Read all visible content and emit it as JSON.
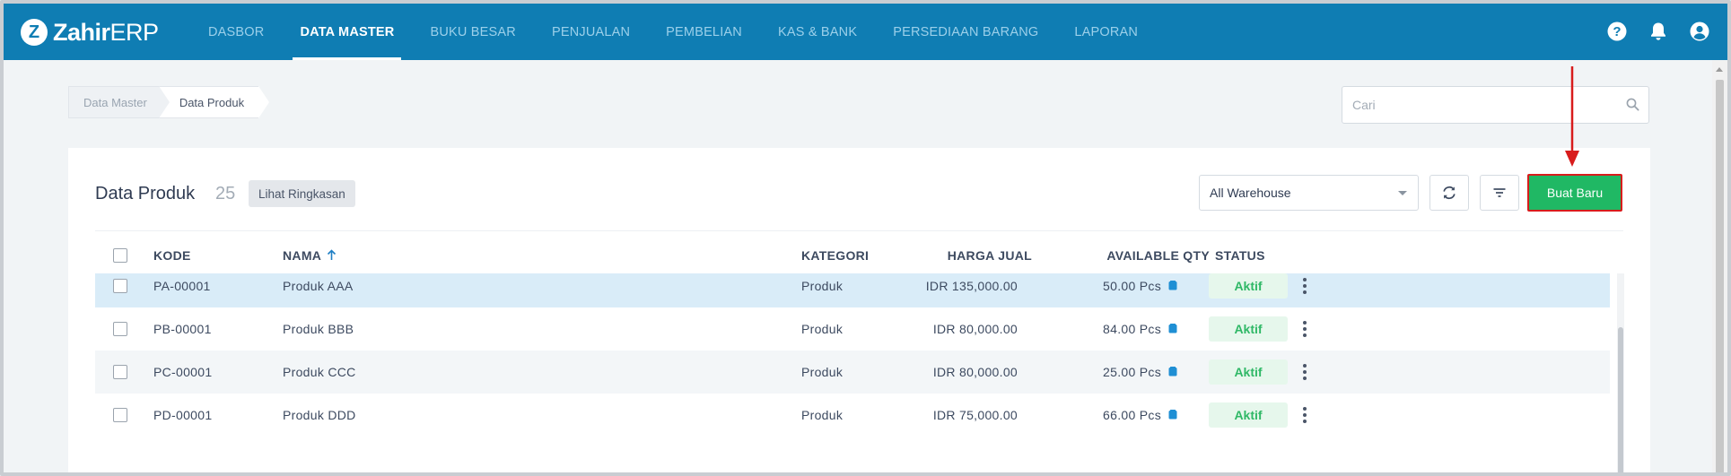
{
  "app": {
    "logo_letter": "Z",
    "logo_bold": "Zahir",
    "logo_light": "ERP"
  },
  "nav": {
    "items": [
      {
        "label": "DASBOR",
        "active": false
      },
      {
        "label": "DATA MASTER",
        "active": true
      },
      {
        "label": "BUKU BESAR",
        "active": false
      },
      {
        "label": "PENJUALAN",
        "active": false
      },
      {
        "label": "PEMBELIAN",
        "active": false
      },
      {
        "label": "KAS & BANK",
        "active": false
      },
      {
        "label": "PERSEDIAAN BARANG",
        "active": false
      },
      {
        "label": "LAPORAN",
        "active": false
      }
    ],
    "icons": [
      "help-icon",
      "bell-icon",
      "user-icon"
    ]
  },
  "breadcrumb": {
    "items": [
      "Data Master",
      "Data Produk"
    ]
  },
  "search": {
    "placeholder": "Cari",
    "value": ""
  },
  "card": {
    "title": "Data Produk",
    "count": "25",
    "summary_label": "Lihat Ringkasan",
    "warehouse_selected": "All Warehouse",
    "new_label": "Buat Baru"
  },
  "table": {
    "columns": {
      "kode": "KODE",
      "nama": "NAMA",
      "kategori": "KATEGORI",
      "harga": "HARGA JUAL",
      "qty": "AVAILABLE QTY",
      "status": "STATUS"
    },
    "sort": {
      "column": "NAMA",
      "direction": "ascending"
    },
    "rows": [
      {
        "kode": "PA-00001",
        "nama": "Produk AAA",
        "kategori": "Produk",
        "harga": "IDR 135,000.00",
        "qty": "50.00 Pcs",
        "status": "Aktif",
        "selected": true
      },
      {
        "kode": "PB-00001",
        "nama": "Produk BBB",
        "kategori": "Produk",
        "harga": "IDR 80,000.00",
        "qty": "84.00 Pcs",
        "status": "Aktif",
        "selected": false
      },
      {
        "kode": "PC-00001",
        "nama": "Produk CCC",
        "kategori": "Produk",
        "harga": "IDR 80,000.00",
        "qty": "25.00 Pcs",
        "status": "Aktif",
        "selected": false
      },
      {
        "kode": "PD-00001",
        "nama": "Produk DDD",
        "kategori": "Produk",
        "harga": "IDR 75,000.00",
        "qty": "66.00 Pcs",
        "status": "Aktif",
        "selected": false
      }
    ]
  },
  "colors": {
    "nav_bg": "#0f7db3",
    "primary_button": "#20b864",
    "annotation_red": "#d81c1c",
    "status_active": "#2fb866",
    "selected_row": "#d9ecf8"
  }
}
